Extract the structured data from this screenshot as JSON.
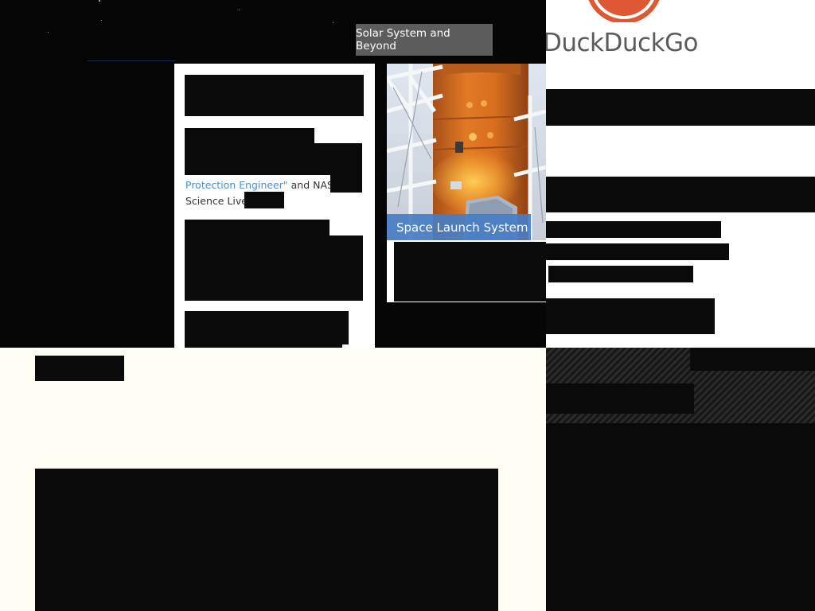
{
  "nasa": {
    "nav": {
      "solar_system_button": "Solar System and Beyond"
    },
    "news": {
      "link_text": "Protection Engineer\"",
      "text_after_link": " and NASA",
      "text_line_2": "Science Lives"
    },
    "feature": {
      "caption": "Space Launch System"
    }
  },
  "ddg": {
    "wordmark": "DuckDuckGo",
    "colors": {
      "logo_ring": "#de5833",
      "logo_green": "#4cba3c"
    }
  }
}
